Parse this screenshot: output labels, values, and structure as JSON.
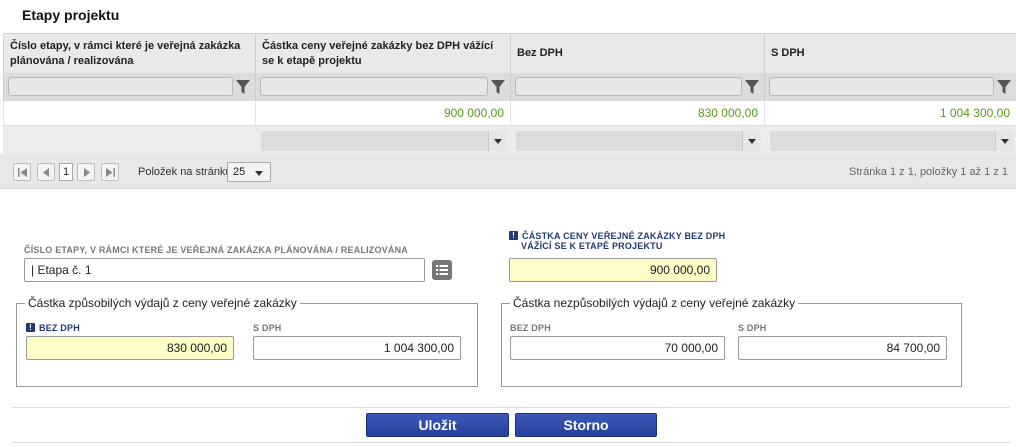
{
  "section_title": "Etapy projektu",
  "grid": {
    "columns": [
      "Číslo etapy, v rámci které je veřejná zakázka plánována / realizována",
      "Částka ceny veřejné zakázky bez DPH vážící se k etapě projektu",
      "Bez DPH",
      "S DPH"
    ],
    "row": [
      "",
      "900 000,00",
      "830 000,00",
      "1 004 300,00"
    ]
  },
  "pager": {
    "current_page": "1",
    "page_size_label": "Položek na stránku",
    "page_size": "25",
    "info": "Stránka 1 z 1, položky 1 až 1 z 1"
  },
  "form": {
    "stage_label": "ČÍSLO ETAPY, V RÁMCI KTERÉ JE VEŘEJNÁ ZAKÁZKA PLÁNOVÁNA / REALIZOVÁNA",
    "stage_value": "| Etapa č. 1",
    "amount_label_line1": "ČÁSTKA CENY VEŘEJNÉ ZAKÁZKY BEZ DPH",
    "amount_label_line2": "VÁŽÍCÍ SE K ETAPĚ PROJEKTU",
    "amount_value": "900 000,00",
    "eligible": {
      "legend": "Částka způsobilých výdajů z ceny veřejné zakázky",
      "bez_label": "BEZ DPH",
      "bez_value": "830 000,00",
      "s_label": "S DPH",
      "s_value": "1 004 300,00"
    },
    "ineligible": {
      "legend": "Částka nezpůsobilých výdajů z ceny veřejné zakázky",
      "bez_label": "BEZ DPH",
      "bez_value": "70 000,00",
      "s_label": "S DPH",
      "s_value": "84 700,00"
    }
  },
  "buttons": {
    "save": "Uložit",
    "cancel": "Storno"
  },
  "colors": {
    "accent": "#2a47a3",
    "required_bg": "#fdfbc6",
    "value_green": "#5a9a1a"
  }
}
